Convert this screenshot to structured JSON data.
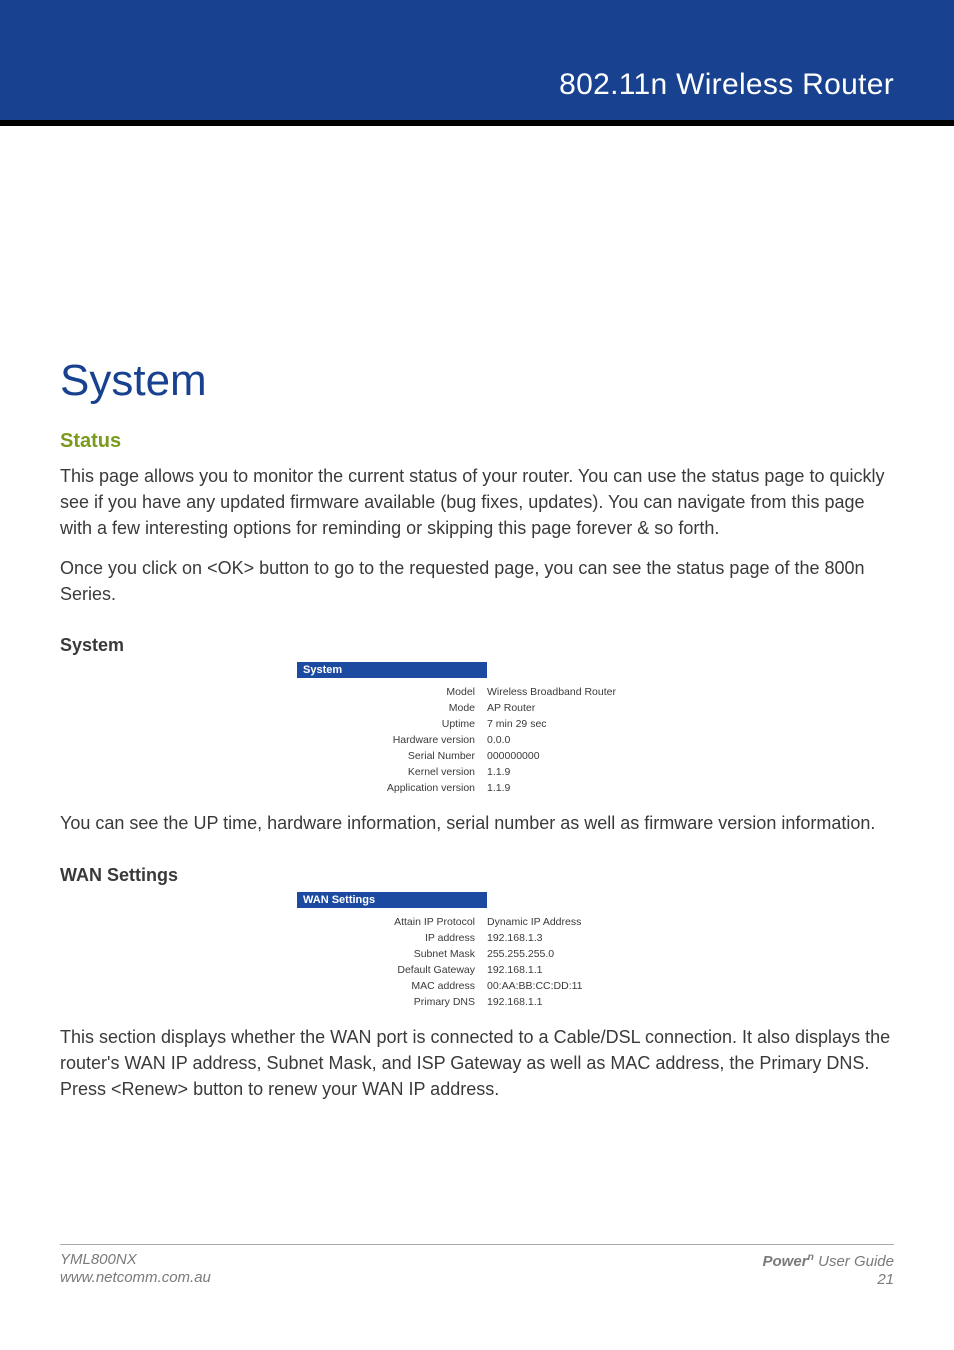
{
  "header": {
    "title": "802.11n Wireless Router"
  },
  "sections": {
    "h1": "System",
    "status_heading": "Status",
    "status_para1": "This page allows you to monitor the current status of your router. You can use the status page to quickly see if you have any updated firmware available (bug fixes, updates). You can navigate from this page with a few interesting options for reminding or skipping this page forever & so forth.",
    "status_para2": "Once you click on <OK> button to go to the requested page, you can see the status page of the 800n Series.",
    "system_heading": "System",
    "system_table": {
      "header": "System",
      "rows": [
        {
          "k": "Model",
          "v": "Wireless Broadband Router"
        },
        {
          "k": "Mode",
          "v": "AP Router"
        },
        {
          "k": "Uptime",
          "v": "7 min 29 sec"
        },
        {
          "k": "Hardware version",
          "v": "0.0.0"
        },
        {
          "k": "Serial Number",
          "v": "000000000"
        },
        {
          "k": "Kernel version",
          "v": "1.1.9"
        },
        {
          "k": "Application version",
          "v": "1.1.9"
        }
      ]
    },
    "system_after": "You can see the UP time, hardware information, serial number as well as firmware version information.",
    "wan_heading": "WAN Settings",
    "wan_table": {
      "header": "WAN Settings",
      "rows": [
        {
          "k": "Attain IP Protocol",
          "v": "Dynamic IP Address"
        },
        {
          "k": "IP address",
          "v": "192.168.1.3"
        },
        {
          "k": "Subnet Mask",
          "v": "255.255.255.0"
        },
        {
          "k": "Default Gateway",
          "v": "192.168.1.1"
        },
        {
          "k": "MAC address",
          "v": "00:AA:BB:CC:DD:11"
        },
        {
          "k": "Primary DNS",
          "v": "192.168.1.1"
        }
      ]
    },
    "wan_after": "This section displays whether the WAN port is connected to a Cable/DSL connection. It also displays the router's WAN IP address, Subnet Mask, and ISP Gateway as well as MAC address, the Primary DNS. Press <Renew> button to renew your WAN IP address."
  },
  "footer": {
    "model": "YML800NX",
    "url": "www.netcomm.com.au",
    "brand_prefix": "Power",
    "brand_sup": "n",
    "guide_suffix": " User Guide",
    "page_number": "21"
  }
}
